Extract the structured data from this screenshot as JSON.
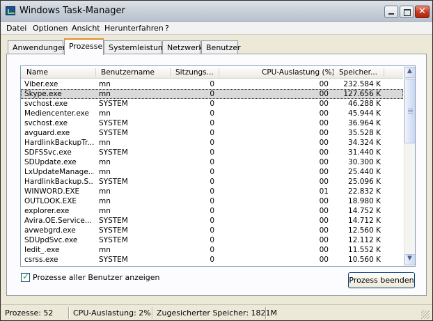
{
  "window": {
    "title": "Windows Task-Manager"
  },
  "menu": [
    "Datei",
    "Optionen",
    "Ansicht",
    "Herunterfahren",
    "?"
  ],
  "tabs": [
    "Anwendungen",
    "Prozesse",
    "Systemleistung",
    "Netzwerk",
    "Benutzer"
  ],
  "active_tab": "Prozesse",
  "columns": [
    "Name",
    "Benutzername",
    "Sitzungs...",
    "CPU-Auslastung (%)",
    "Speicher..."
  ],
  "processes": [
    {
      "name": "Viber.exe",
      "user": "mn",
      "session": "0",
      "cpu": "00",
      "memory": "232.584 K"
    },
    {
      "name": "Skype.exe",
      "user": "mn",
      "session": "0",
      "cpu": "00",
      "memory": "127.656 K",
      "selected": true
    },
    {
      "name": "svchost.exe",
      "user": "SYSTEM",
      "session": "0",
      "cpu": "00",
      "memory": "46.288 K"
    },
    {
      "name": "Mediencenter.exe",
      "user": "mn",
      "session": "0",
      "cpu": "00",
      "memory": "45.944 K"
    },
    {
      "name": "svchost.exe",
      "user": "SYSTEM",
      "session": "0",
      "cpu": "00",
      "memory": "36.964 K"
    },
    {
      "name": "avguard.exe",
      "user": "SYSTEM",
      "session": "0",
      "cpu": "00",
      "memory": "35.528 K"
    },
    {
      "name": "HardlinkBackupTr...",
      "user": "mn",
      "session": "0",
      "cpu": "00",
      "memory": "34.324 K"
    },
    {
      "name": "SDFSSvc.exe",
      "user": "SYSTEM",
      "session": "0",
      "cpu": "00",
      "memory": "31.440 K"
    },
    {
      "name": "SDUpdate.exe",
      "user": "mn",
      "session": "0",
      "cpu": "00",
      "memory": "30.300 K"
    },
    {
      "name": "LxUpdateManage...",
      "user": "mn",
      "session": "0",
      "cpu": "00",
      "memory": "25.440 K"
    },
    {
      "name": "HardlinkBackup.S...",
      "user": "SYSTEM",
      "session": "0",
      "cpu": "00",
      "memory": "25.096 K"
    },
    {
      "name": "WINWORD.EXE",
      "user": "mn",
      "session": "0",
      "cpu": "01",
      "memory": "22.832 K"
    },
    {
      "name": "OUTLOOK.EXE",
      "user": "mn",
      "session": "0",
      "cpu": "00",
      "memory": "18.980 K"
    },
    {
      "name": "explorer.exe",
      "user": "mn",
      "session": "0",
      "cpu": "00",
      "memory": "14.752 K"
    },
    {
      "name": "Avira.OE.Service...",
      "user": "SYSTEM",
      "session": "0",
      "cpu": "00",
      "memory": "14.712 K"
    },
    {
      "name": "avwebgrd.exe",
      "user": "SYSTEM",
      "session": "0",
      "cpu": "00",
      "memory": "12.560 K"
    },
    {
      "name": "SDUpdSvc.exe",
      "user": "SYSTEM",
      "session": "0",
      "cpu": "00",
      "memory": "12.112 K"
    },
    {
      "name": "Iedit_.exe",
      "user": "mn",
      "session": "0",
      "cpu": "00",
      "memory": "11.552 K"
    },
    {
      "name": "csrss.exe",
      "user": "SYSTEM",
      "session": "0",
      "cpu": "00",
      "memory": "10.560 K"
    }
  ],
  "show_all_users": {
    "label": "Prozesse aller Benutzer anzeigen",
    "checked": true
  },
  "end_process_button": "Prozess beenden",
  "statusbar": {
    "processes": "Prozesse: 52",
    "cpu": "CPU-Auslastung: 2%",
    "memory": "Zugesicherter Speicher: 1821M"
  }
}
